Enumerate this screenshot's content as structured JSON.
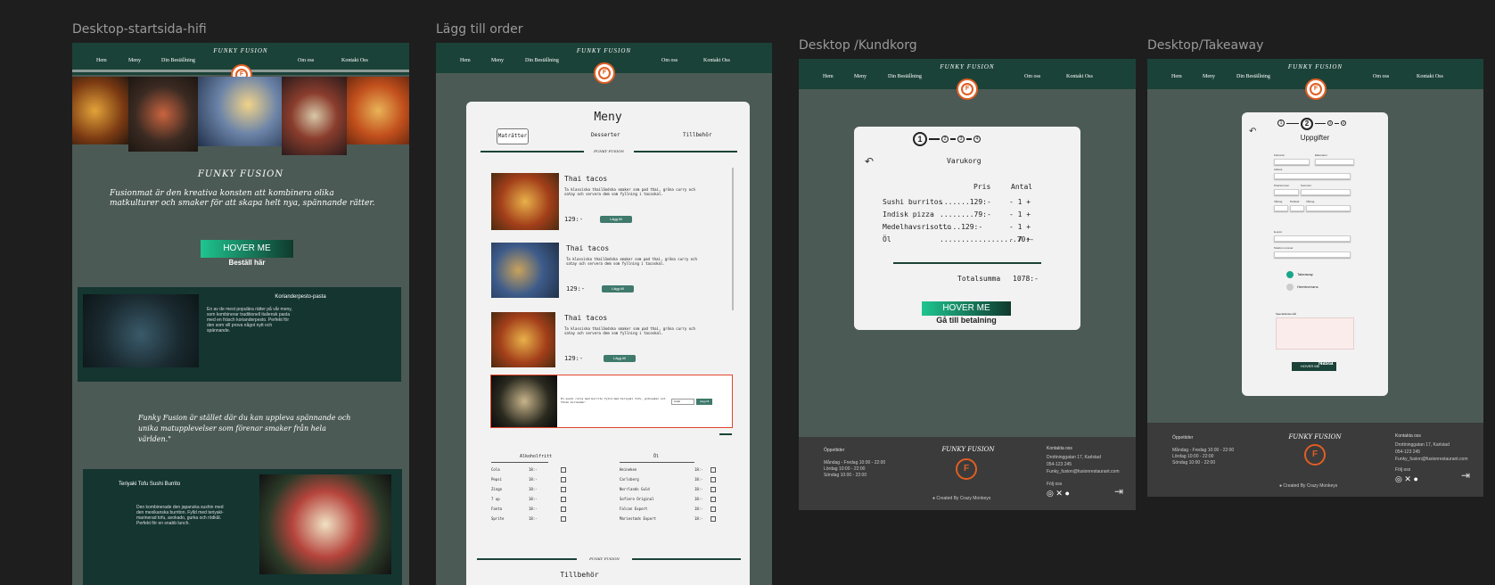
{
  "frames": {
    "f1": {
      "label": "Desktop-startsida-hifi",
      "nav": [
        "Hem",
        "Meny",
        "Din Beställning",
        "Om oss",
        "Kontakt Oss"
      ],
      "brand": "FUNKY FUSION",
      "hero_title": "FUNKY FUSION",
      "hero_text": "Fusionmat är den kreativa konsten att kombinera olika matkulturer och smaker för att skapa helt nya, spännande rätter.",
      "cta": "HOVER ME",
      "cta_sub": "Beställ här",
      "feature1_title": "Korianderpesto-pasta",
      "feature1_text": "En av de mest populära rätter på vår meny, som kombinerar traditionell italiensk pasta med en fräsch korianderpesto. Perfekt för den som vill prova något nytt och spännande.",
      "quote": "Funky Fusion är stället där du kan uppleva spännande och unika matupplevelser som förenar smaker från hela världen.\"",
      "feature2_title": "Teriyaki Tofu Sushi Burrito",
      "feature2_text": "Den kombinerade den japanska sushin med den mexikanska burriton. Fylld med teriyaki-marinerad tofu, avokado, gurka och rödkål. Perfekt för en snabb lunch."
    },
    "f2": {
      "label": "Lägg till order",
      "nav": [
        "Hem",
        "Meny",
        "Din Beställning",
        "Om oss",
        "Kontakt Oss"
      ],
      "brand": "FUNKY FUSION",
      "menu_title": "Meny",
      "tabs": [
        "Maträtter",
        "Desserter",
        "Tillbehör"
      ],
      "divider_label": "FUNKY FUSION",
      "items": [
        {
          "name": "Thai tacos",
          "desc": "Ta klassiska thailändska smaker som pad thai, gröna curry och satay och servera dem som fyllning i tacoskal.",
          "price": "129:-",
          "btn": "Lägg till"
        },
        {
          "name": "Thai tacos",
          "desc": "Ta klassiska thailändska smaker som pad thai, gröna curry och satay och servera dem som fyllning i tacoskal.",
          "price": "129:-",
          "btn": "Lägg till"
        },
        {
          "name": "Thai tacos",
          "desc": "Ta klassiska thailändska smaker som pad thai, gröna curry och satay och servera dem som fyllning i tacoskal.",
          "price": "129:-",
          "btn": "Lägg till"
        }
      ],
      "selected_text": "En sushi rulle med burrito fylld med teriyaki tofu, grönsaker och färsk koriander.",
      "selected_qty": "Antal",
      "selected_btn": "Lägg till",
      "drinks_title": "Alkoholfritt",
      "drinks": [
        {
          "name": "Cola",
          "price": "18:-"
        },
        {
          "name": "Pepsi",
          "price": "18:-"
        },
        {
          "name": "Zingo",
          "price": "18:-"
        },
        {
          "name": "7 up",
          "price": "18:-"
        },
        {
          "name": "Fanta",
          "price": "18:-"
        },
        {
          "name": "Sprite",
          "price": "18:-"
        }
      ],
      "beer_title": "Öl",
      "beers": [
        {
          "name": "Heineken",
          "price": "18:-"
        },
        {
          "name": "Carlsberg",
          "price": "18:-"
        },
        {
          "name": "Norrlands Guld",
          "price": "18:-"
        },
        {
          "name": "Sofiero Original",
          "price": "18:-"
        },
        {
          "name": "Falcon Export",
          "price": "18:-"
        },
        {
          "name": "Mariestads Export",
          "price": "18:-"
        }
      ],
      "footer_brand": "FUNKY FUSION",
      "sides_title": "Tillbehör"
    },
    "f3": {
      "label": "Desktop /Kundkorg",
      "nav": [
        "Hem",
        "Meny",
        "Din Beställning",
        "Om oss",
        "Kontakt Oss"
      ],
      "brand": "FUNKY FUSION",
      "steps": [
        "1",
        "2",
        "3",
        "4"
      ],
      "cart_title": "Varukorg",
      "col_price": "Pris",
      "col_qty": "Antal",
      "rows": [
        {
          "name": "Sushi burritos",
          "price": ".......129:-",
          "qty": "- 1 +"
        },
        {
          "name": "Indisk pizza",
          "price": "........79:-",
          "qty": "- 1 +"
        },
        {
          "name": "Medelhavsrisotto",
          "price": ".....129:-",
          "qty": "- 1 +"
        },
        {
          "name": "Öl",
          "price": "..................70:-",
          "qty": "- 7 +"
        }
      ],
      "total_label": "Totalsumma",
      "total_value": "1078:-",
      "cta": "HOVER ME",
      "cta_sub": "Gå till betalning",
      "footer": {
        "hours_title": "Öppettider",
        "hours": [
          "Måndag - Fredag    10:00 - 22:00",
          "Lördag    10:00 - 22:00",
          "Söndag    10:00 - 22:00"
        ],
        "brand": "FUNKY FUSION",
        "contact_title": "Kontakta oss",
        "contact": [
          "Drottninggatan 17, Karlstad",
          "054-123 245",
          "Funky_fusion@fusionrestaurant.com"
        ],
        "follow": "Följ oss",
        "credit": "Created By Crazy Monkeys"
      }
    },
    "f4": {
      "label": "Desktop/Takeaway",
      "nav": [
        "Hem",
        "Meny",
        "Din Beställning",
        "Om oss",
        "Kontakt Oss"
      ],
      "brand": "FUNKY FUSION",
      "steps": [
        "1",
        "2",
        "3",
        "4"
      ],
      "title": "Uppgifter",
      "fields": [
        "Förnamn",
        "Efternamn",
        "Adress",
        "Postnummer",
        "Kommun",
        "Våning",
        "Portkod",
        "Våning",
        "E-post",
        "Telefon nummer"
      ],
      "radio1": "Takeaway",
      "radio2": "Hemleverans",
      "notes_label": "Specialönskemål",
      "cta": "HOVER ME",
      "cta_sub": "Nästa",
      "footer": {
        "hours_title": "Öppettider",
        "hours": [
          "Måndag - Fredag    10:00 - 22:00",
          "Lördag    10:00 - 22:00",
          "Söndag    10:00 - 22:00"
        ],
        "brand": "FUNKY FUSION",
        "contact_title": "Kontakta oss",
        "contact": [
          "Drottninggatan 17, Karlstad",
          "054-123 245",
          "Funky_fusion@fusionrestaurant.com"
        ],
        "follow": "Följ oss",
        "credit": "Created By Crazy Monkeys"
      }
    }
  }
}
